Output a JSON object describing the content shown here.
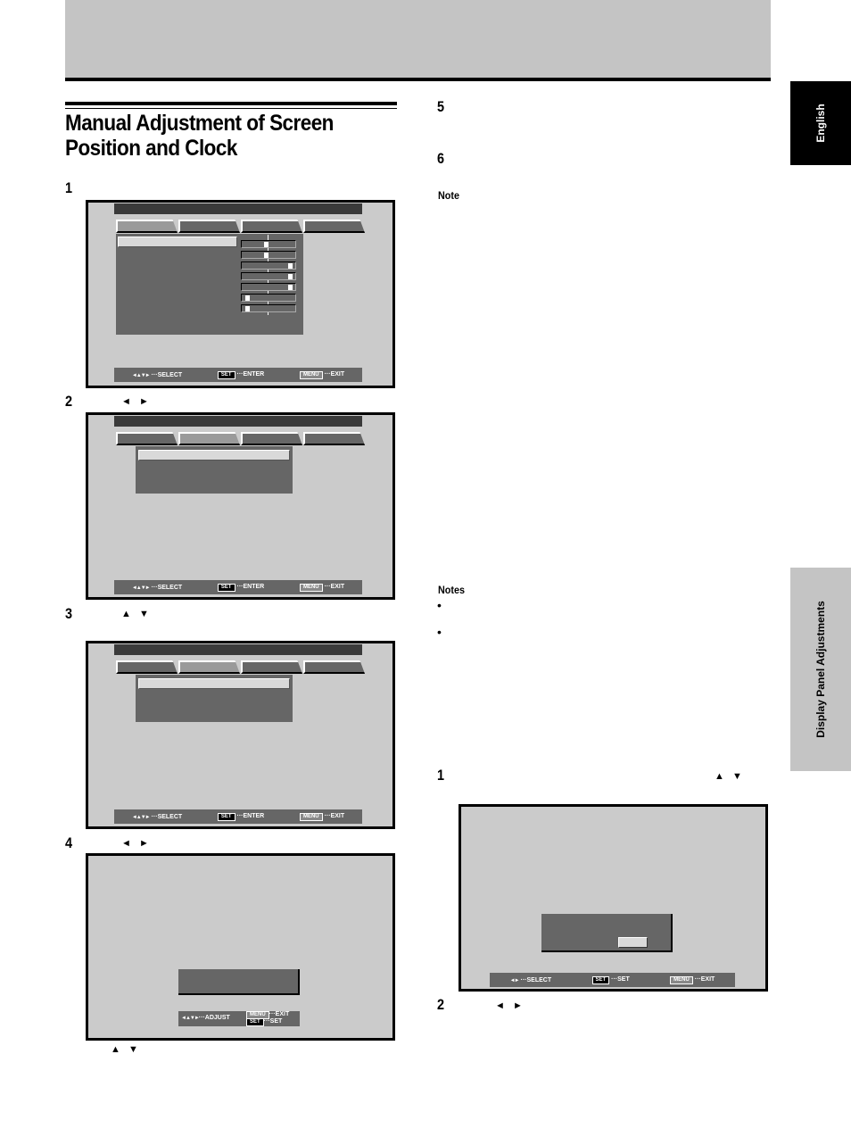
{
  "page": {
    "title": "Manual Adjustment of Screen Position and Clock",
    "title_line1": "Manual Adjustment of Screen",
    "title_line2": "Position and Clock"
  },
  "side_tabs": {
    "language": "English",
    "section": "Display Panel Adjustments"
  },
  "steps_left": [
    {
      "num": "1",
      "arrows": ""
    },
    {
      "num": "2",
      "arrows": "◄ ►"
    },
    {
      "num": "3",
      "arrows": "▲ ▼"
    },
    {
      "num": "4",
      "arrows": "◄ ►"
    }
  ],
  "step4_after_arrows": "▲ ▼",
  "steps_right": [
    {
      "num": "5"
    },
    {
      "num": "6"
    }
  ],
  "note_heading": "Note",
  "notes_heading": "Notes",
  "notes_bullets": [
    "•",
    "•"
  ],
  "steps_right2": [
    {
      "num": "1",
      "arrows": "▲ ▼"
    },
    {
      "num": "2",
      "arrows": "◄ ►"
    }
  ],
  "osd": {
    "select": "SELECT",
    "enter": "ENTER",
    "exit": "EXIT",
    "adjust": "ADJUST",
    "set": "SET",
    "key_set": "SET",
    "key_menu": "MENU",
    "dots": "···",
    "dpad": "◄▲▼►",
    "lr": "◄►",
    "screen1_sliders": [
      0.45,
      0.45,
      0.95,
      0.95,
      0.95,
      0.05,
      0.05
    ]
  }
}
